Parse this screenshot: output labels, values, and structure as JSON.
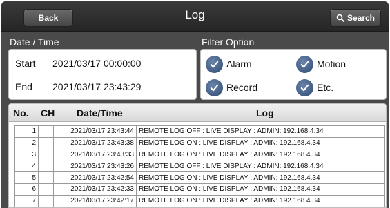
{
  "header": {
    "back_label": "Back",
    "title": "Log",
    "search_label": "Search"
  },
  "datetime": {
    "section_label": "Date / Time",
    "start_label": "Start",
    "start_value": "2021/03/17 00:00:00",
    "end_label": "End",
    "end_value": "2021/03/17 23:43:29"
  },
  "filter": {
    "section_label": "Filter Option",
    "options": [
      {
        "label": "Alarm",
        "checked": true
      },
      {
        "label": "Motion",
        "checked": true
      },
      {
        "label": "Record",
        "checked": true
      },
      {
        "label": "Etc.",
        "checked": true
      }
    ]
  },
  "log_table": {
    "columns": [
      "No.",
      "CH",
      "Date/Time",
      "Log"
    ],
    "rows": [
      {
        "no": "1",
        "ch": "",
        "datetime": "2021/03/17 23:43:44",
        "log": "REMOTE LOG OFF : LIVE DISPLAY : ADMIN: 192.168.4.34"
      },
      {
        "no": "2",
        "ch": "",
        "datetime": "2021/03/17 23:43:38",
        "log": "REMOTE LOG ON : LIVE DISPLAY : ADMIN: 192.168.4.34"
      },
      {
        "no": "3",
        "ch": "",
        "datetime": "2021/03/17 23:43:33",
        "log": "REMOTE LOG ON : LIVE DISPLAY : ADMIN: 192.168.4.34"
      },
      {
        "no": "4",
        "ch": "",
        "datetime": "2021/03/17 23:43:26",
        "log": "REMOTE LOG OFF : LIVE DISPLAY : ADMIN: 192.168.4.34"
      },
      {
        "no": "5",
        "ch": "",
        "datetime": "2021/03/17 23:42:54",
        "log": "REMOTE LOG ON : LIVE DISPLAY : ADMIN: 192.168.4.34"
      },
      {
        "no": "6",
        "ch": "",
        "datetime": "2021/03/17 23:42:33",
        "log": "REMOTE LOG ON : LIVE DISPLAY : ADMIN: 192.168.4.34"
      },
      {
        "no": "7",
        "ch": "",
        "datetime": "2021/03/17 23:42:17",
        "log": "REMOTE LOG ON : LIVE DISPLAY : ADMIN: 192.168.4.34"
      }
    ]
  },
  "colors": {
    "background": "#4a4a4a",
    "topbar": "#262626",
    "check_accent": "#2e4a73"
  }
}
